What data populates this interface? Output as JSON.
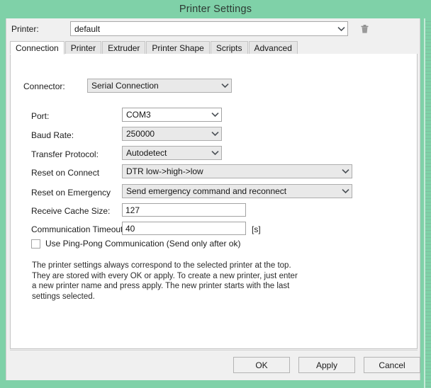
{
  "window": {
    "title": "Printer Settings",
    "chrome_color": "#7fd1a8",
    "dialog_bg": "#f0f0f0"
  },
  "printer_row": {
    "label": "Printer:",
    "selected": "default",
    "delete_icon": "trash-icon"
  },
  "tabs": [
    {
      "label": "Connection",
      "active": true
    },
    {
      "label": "Printer",
      "active": false
    },
    {
      "label": "Extruder",
      "active": false
    },
    {
      "label": "Printer Shape",
      "active": false
    },
    {
      "label": "Scripts",
      "active": false
    },
    {
      "label": "Advanced",
      "active": false
    }
  ],
  "connection": {
    "connector": {
      "label": "Connector:",
      "value": "Serial Connection"
    },
    "port": {
      "label": "Port:",
      "value": "COM3"
    },
    "baud_rate": {
      "label": "Baud Rate:",
      "value": "250000"
    },
    "transfer_protocol": {
      "label": "Transfer Protocol:",
      "value": "Autodetect"
    },
    "reset_on_connect": {
      "label": "Reset on Connect",
      "value": "DTR low->high->low"
    },
    "reset_on_emergency": {
      "label": "Reset on Emergency",
      "value": "Send emergency command and reconnect"
    },
    "receive_cache_size": {
      "label": "Receive Cache Size:",
      "value": "127"
    },
    "communication_timeout": {
      "label": "Communication Timeout:",
      "value": "40",
      "unit": "[s]"
    },
    "ping_pong": {
      "label": "Use Ping-Pong Communication (Send only after ok)",
      "checked": false
    },
    "help_text": "The printer settings always correspond to the selected printer at the top. They are stored with every OK or apply. To create a new printer, just enter a new printer name and press apply. The new printer starts with the last settings selected."
  },
  "footer": {
    "ok": "OK",
    "apply": "Apply",
    "cancel": "Cancel"
  }
}
